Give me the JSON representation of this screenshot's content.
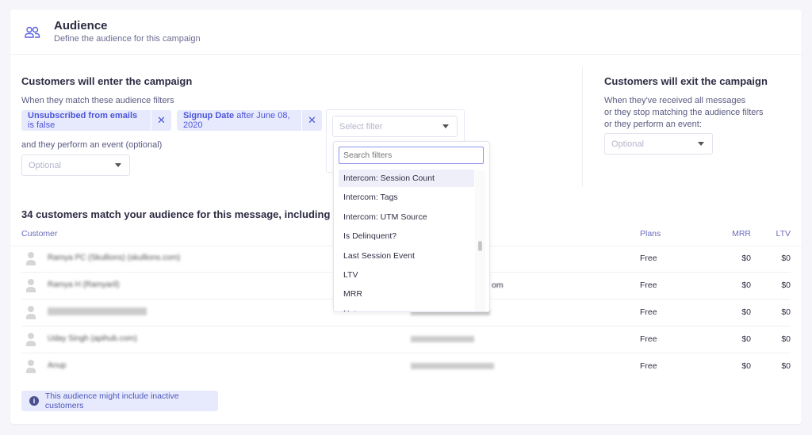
{
  "header": {
    "title": "Audience",
    "subtitle": "Define the audience for this campaign",
    "icon": "users-icon"
  },
  "enter": {
    "title": "Customers will enter the campaign",
    "filters_label": "When they match these audience filters",
    "chips": [
      {
        "field": "Unsubscribed from emails",
        "condition": "is false"
      },
      {
        "field": "Signup Date",
        "condition": "after June 08, 2020"
      }
    ],
    "remove_glyph": "✕",
    "select_filter_placeholder": "Select filter",
    "event_label": "and they perform an event (optional)",
    "event_placeholder": "Optional"
  },
  "exit": {
    "title": "Customers will exit the campaign",
    "lines": [
      "When they've received all messages",
      "or they stop matching the audience filters",
      "or they perform an event:"
    ],
    "event_placeholder": "Optional"
  },
  "dropdown": {
    "search_placeholder": "Search filters",
    "items": [
      "Intercom: Session Count",
      "Intercom: Tags",
      "Intercom: UTM Source",
      "Is Delinquent?",
      "Last Session Event",
      "LTV",
      "MRR",
      "Notes"
    ],
    "highlighted": "Intercom: Session Count"
  },
  "matches": {
    "title": "34 customers match your audience for this message, including",
    "columns": {
      "customer": "Customer",
      "plans": "Plans",
      "mrr": "MRR",
      "ltv": "LTV"
    },
    "rows": [
      {
        "name": "Ramya PC (Skullions) (skullions.com)",
        "email": "",
        "plan": "Free",
        "mrr": "$0",
        "ltv": "$0"
      },
      {
        "name": "Ramya H (Ramyaril)",
        "email": "om",
        "plan": "Free",
        "mrr": "$0",
        "ltv": "$0"
      },
      {
        "name": "",
        "email": "",
        "plan": "Free",
        "mrr": "$0",
        "ltv": "$0"
      },
      {
        "name": "Uday Singh (apihub.com)",
        "email": "",
        "plan": "Free",
        "mrr": "$0",
        "ltv": "$0"
      },
      {
        "name": "Anup",
        "email": "",
        "plan": "Free",
        "mrr": "$0",
        "ltv": "$0"
      }
    ]
  },
  "notice": {
    "text": "This audience might include inactive customers",
    "icon": "info-icon"
  },
  "colors": {
    "accent": "#4d55d9",
    "chip_bg": "#e7eafd",
    "background": "#f5f5fa"
  }
}
